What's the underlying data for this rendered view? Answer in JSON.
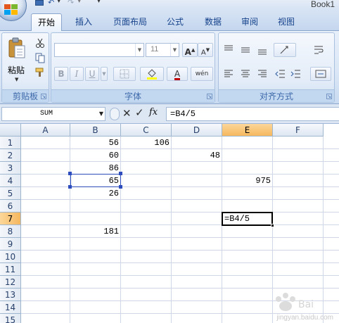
{
  "window": {
    "title": "Book1"
  },
  "quick_access": {
    "icons": [
      "save-icon",
      "undo-icon",
      "redo-icon",
      "customize-icon"
    ]
  },
  "tabs": [
    {
      "label": "开始",
      "active": true
    },
    {
      "label": "插入",
      "active": false
    },
    {
      "label": "页面布局",
      "active": false
    },
    {
      "label": "公式",
      "active": false
    },
    {
      "label": "数据",
      "active": false
    },
    {
      "label": "审阅",
      "active": false
    },
    {
      "label": "视图",
      "active": false
    }
  ],
  "ribbon": {
    "clipboard": {
      "label": "剪贴板",
      "paste_label": "粘贴"
    },
    "font": {
      "label": "字体",
      "font_name": "",
      "font_size": "11",
      "bold": "B",
      "italic": "I",
      "underline": "U",
      "grow": "A",
      "shrink": "A",
      "font_color": "A",
      "phonetic": "wén"
    },
    "alignment": {
      "label": "对齐方式"
    }
  },
  "formula_bar": {
    "name_box": "SUM",
    "formula": "=B4/5"
  },
  "sheet": {
    "columns": [
      "A",
      "B",
      "C",
      "D",
      "E",
      "F"
    ],
    "selected_column": "E",
    "rows": [
      "1",
      "2",
      "3",
      "4",
      "5",
      "6",
      "7",
      "8",
      "9",
      "10",
      "11",
      "12",
      "13",
      "14",
      "15"
    ],
    "selected_row": "7",
    "cells": [
      {
        "ref": "B1",
        "value": "56"
      },
      {
        "ref": "C1",
        "value": "106"
      },
      {
        "ref": "B2",
        "value": "60"
      },
      {
        "ref": "D2",
        "value": "48"
      },
      {
        "ref": "B3",
        "value": "86"
      },
      {
        "ref": "B4",
        "value": "65"
      },
      {
        "ref": "E4",
        "value": "975"
      },
      {
        "ref": "B5",
        "value": "26"
      },
      {
        "ref": "B8",
        "value": "181"
      }
    ],
    "referenced_cell": "B4",
    "active_cell": {
      "ref": "E7",
      "text": "=B4/5"
    }
  },
  "colors": {
    "selected_header": "#f5b75e",
    "reference_border": "#2d4dbf",
    "tab_text": "#15428b"
  }
}
